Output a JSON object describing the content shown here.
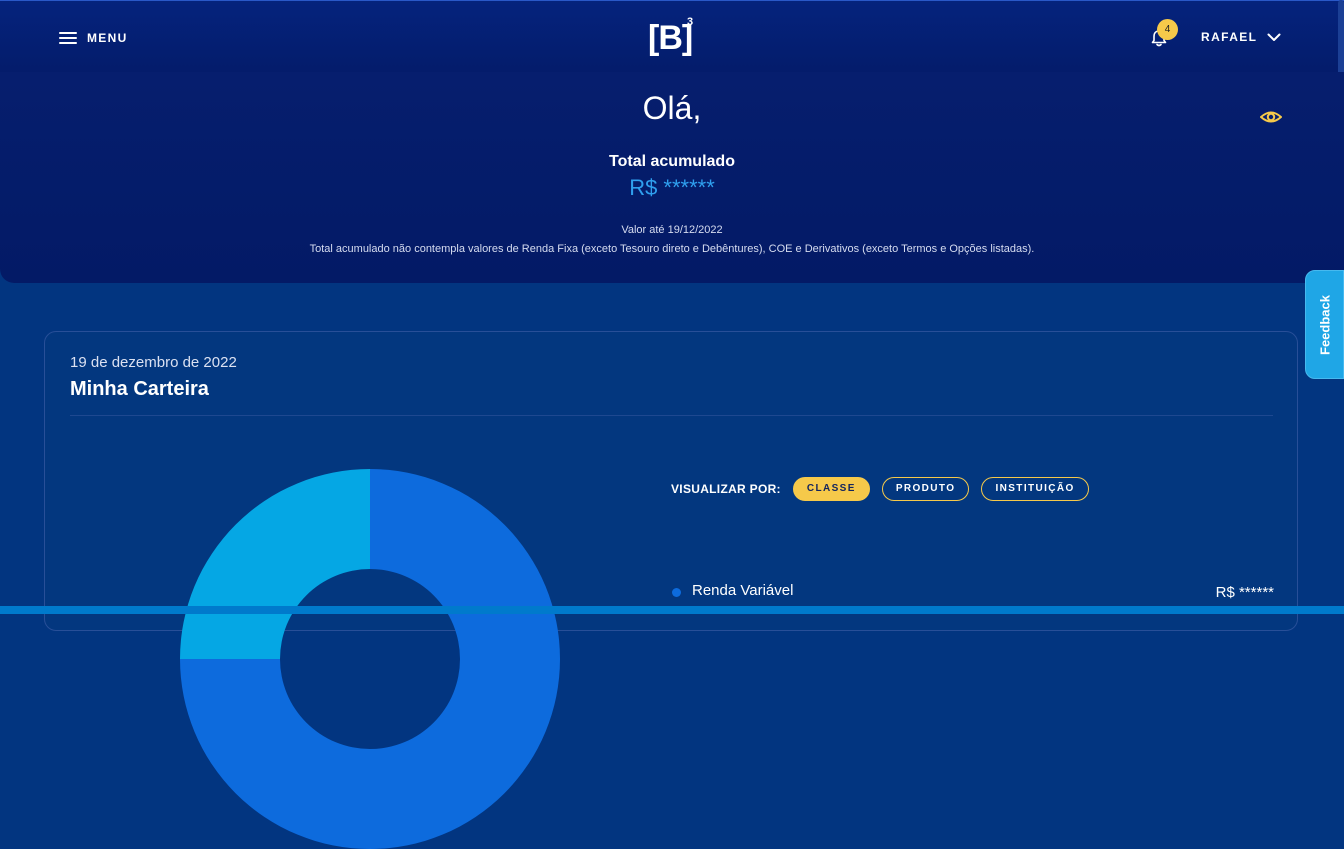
{
  "header": {
    "menu_label": "MENU",
    "logo_text": "[B]",
    "logo_sup": "3",
    "notification_count": "4",
    "user_name": "RAFAEL"
  },
  "hero": {
    "greeting": "Olá,",
    "total_label": "Total acumulado",
    "total_value": "R$ ******",
    "valor_ate": "Valor até 19/12/2022",
    "disclaimer": "Total acumulado não contempla valores de Renda Fixa (exceto Tesouro direto e Debêntures), COE e Derivativos (exceto Termos e Opções listadas)."
  },
  "feedback_label": "Feedback",
  "card": {
    "date": "19 de dezembro de 2022",
    "title": "Minha Carteira",
    "view_by_label": "VISUALIZAR POR:",
    "view_options": [
      "CLASSE",
      "PRODUTO",
      "INSTITUIÇÃO"
    ],
    "active_view": "CLASSE",
    "legend": [
      {
        "label": "Renda Variável",
        "value": "R$ ******",
        "color": "#0d6bdd"
      }
    ]
  },
  "colors": {
    "accent": "#f6c94a",
    "value_blue": "#2f9fee",
    "donut_dark": "#0d6bdd",
    "donut_light": "#05a7e4"
  }
}
